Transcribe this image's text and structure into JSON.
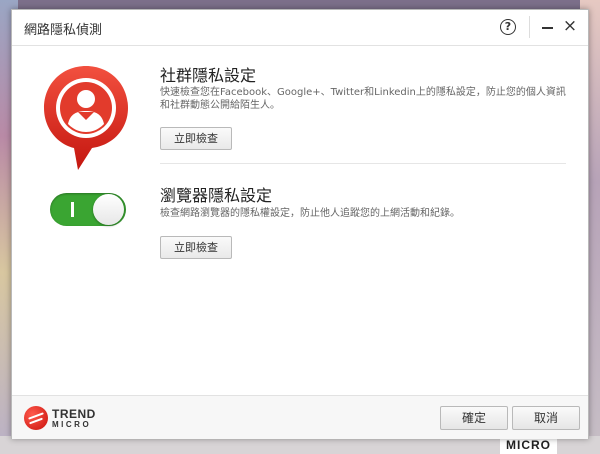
{
  "window": {
    "title": "網路隱私偵測",
    "help_symbol": "?",
    "close_symbol": "×"
  },
  "social": {
    "title": "社群隱私設定",
    "description": "快速檢查您在Facebook、Google+、Twitter和Linkedin上的隱私設定，防止您的個人資訊和社群動態公開給陌生人。",
    "button_label": "立即檢查"
  },
  "browser": {
    "title": "瀏覽器隱私設定",
    "description": "檢查網路瀏覽器的隱私權設定，防止他人追蹤您的上網活動和紀錄。",
    "button_label": "立即檢查",
    "toggle_state": "on"
  },
  "footer": {
    "brand_line1": "TREND",
    "brand_line2": "MICRO",
    "ok_label": "確定",
    "cancel_label": "取消"
  },
  "desktop": {
    "logo_text": "MICRO"
  },
  "colors": {
    "brand_red": "#d8231c",
    "toggle_green": "#3aa532"
  }
}
